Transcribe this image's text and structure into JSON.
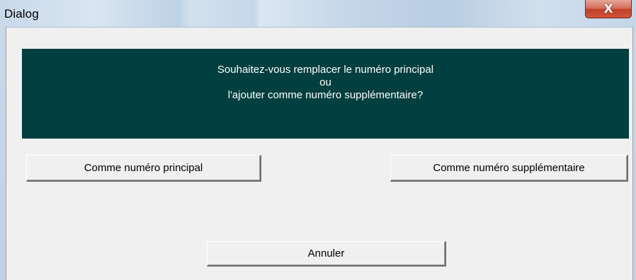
{
  "window": {
    "title": "Dialog",
    "close_glyph": "X"
  },
  "message": {
    "line1": "Souhaitez-vous remplacer le numéro principal",
    "line2": "ou",
    "line3": "l'ajouter comme numéro supplémentaire?"
  },
  "buttons": {
    "principal": "Comme numéro principal",
    "supplementaire": "Comme numéro supplémentaire",
    "cancel": "Annuler"
  },
  "colors": {
    "message_background": "#003f3f",
    "message_text": "#ffffff",
    "dialog_background": "#f0f0f0",
    "close_button": "#c7432d"
  },
  "icons": {
    "close": "close-icon"
  }
}
